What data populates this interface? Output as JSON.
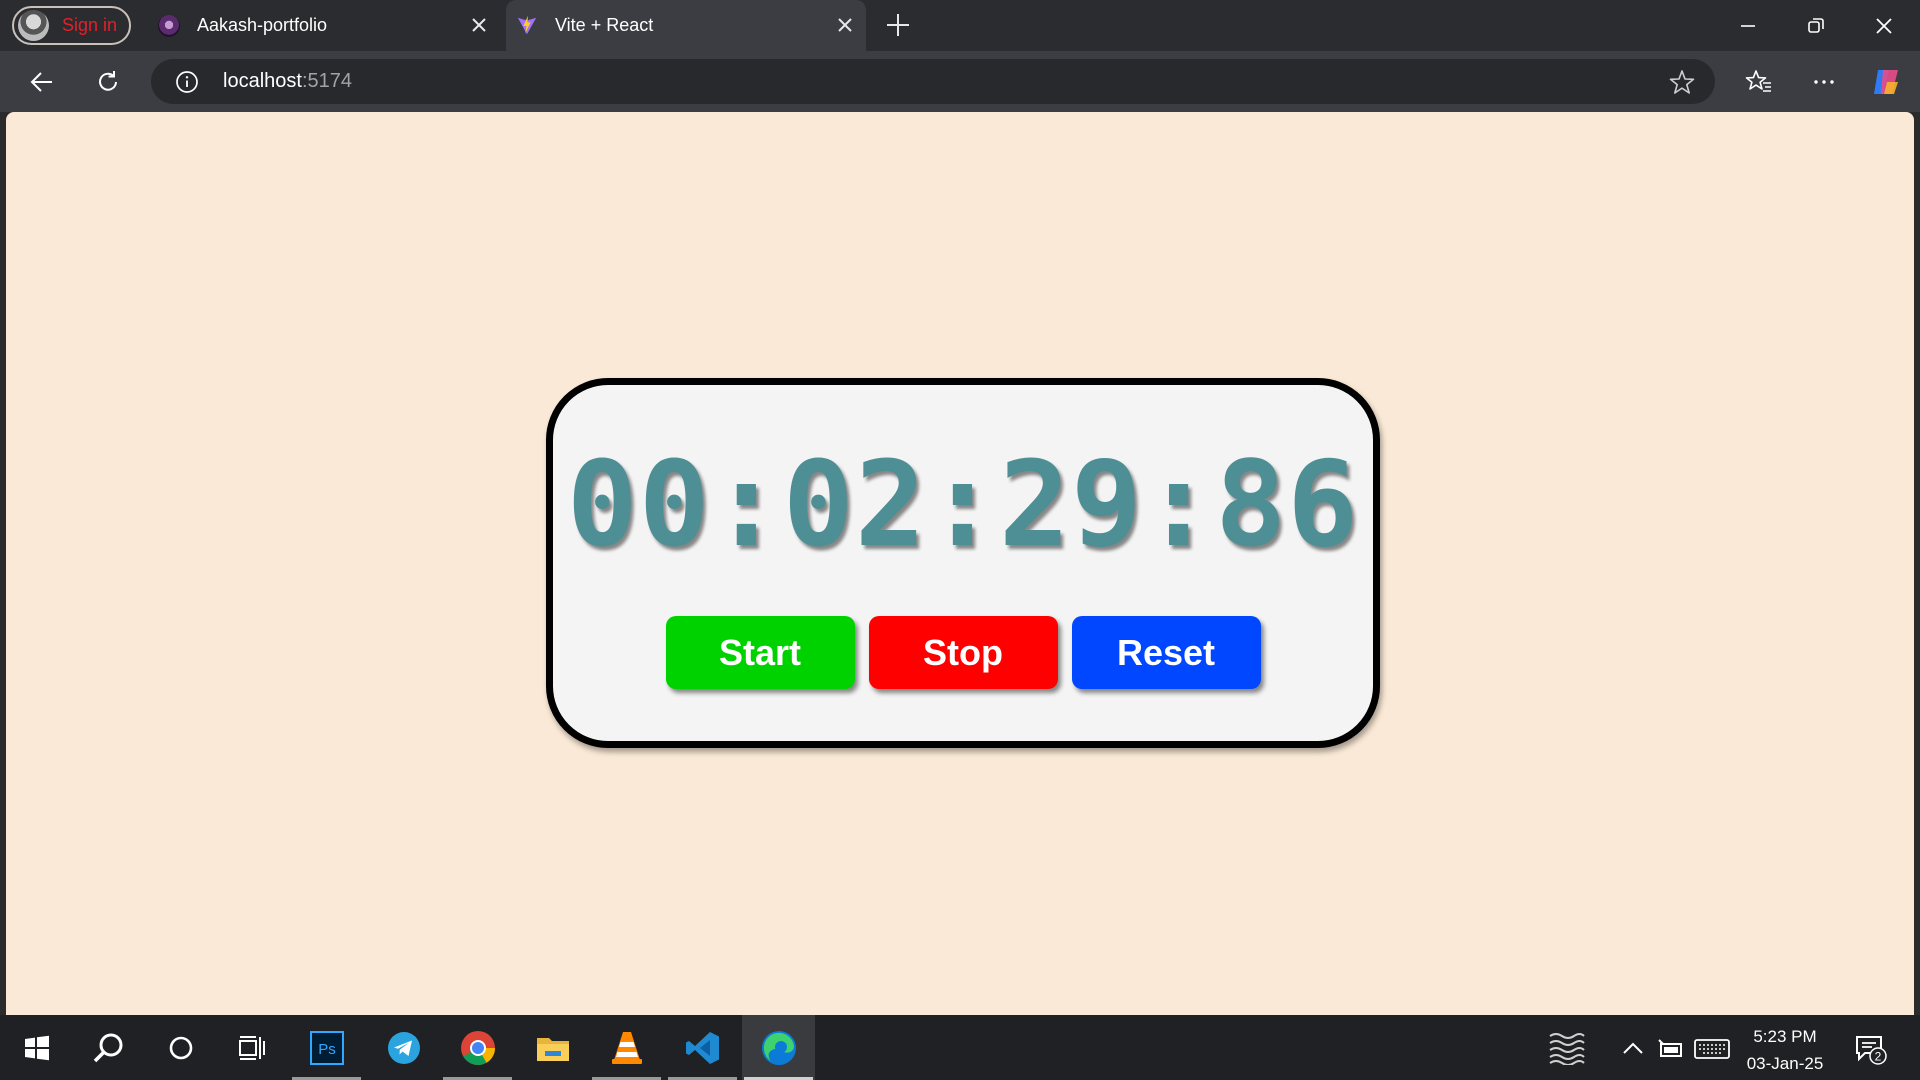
{
  "browser": {
    "profile": {
      "label": "Sign in"
    },
    "tabs": [
      {
        "title": "Aakash-portfolio",
        "favicon": "portfolio-avatar-icon",
        "active": false
      },
      {
        "title": "Vite + React",
        "favicon": "vite-logo-icon",
        "active": true
      }
    ],
    "address": {
      "host": "localhost",
      "port": ":5174"
    }
  },
  "page": {
    "background": "#fae9d6",
    "stopwatch": {
      "time": "00:02:29:86",
      "time_color": "#4d8f95",
      "buttons": [
        {
          "label": "Start",
          "color": "#00d200"
        },
        {
          "label": "Stop",
          "color": "#ff0000"
        },
        {
          "label": "Reset",
          "color": "#0047ff"
        }
      ]
    }
  },
  "taskbar": {
    "apps": [
      "windows-start-icon",
      "search-icon",
      "cortana-icon",
      "task-view-icon",
      "photoshop-icon",
      "telegram-icon",
      "chrome-icon",
      "file-explorer-icon",
      "vlc-icon",
      "vscode-icon",
      "edge-icon"
    ],
    "clock": {
      "time": "5:23 PM",
      "date": "03-Jan-25"
    },
    "notifications": {
      "count": "2"
    }
  }
}
